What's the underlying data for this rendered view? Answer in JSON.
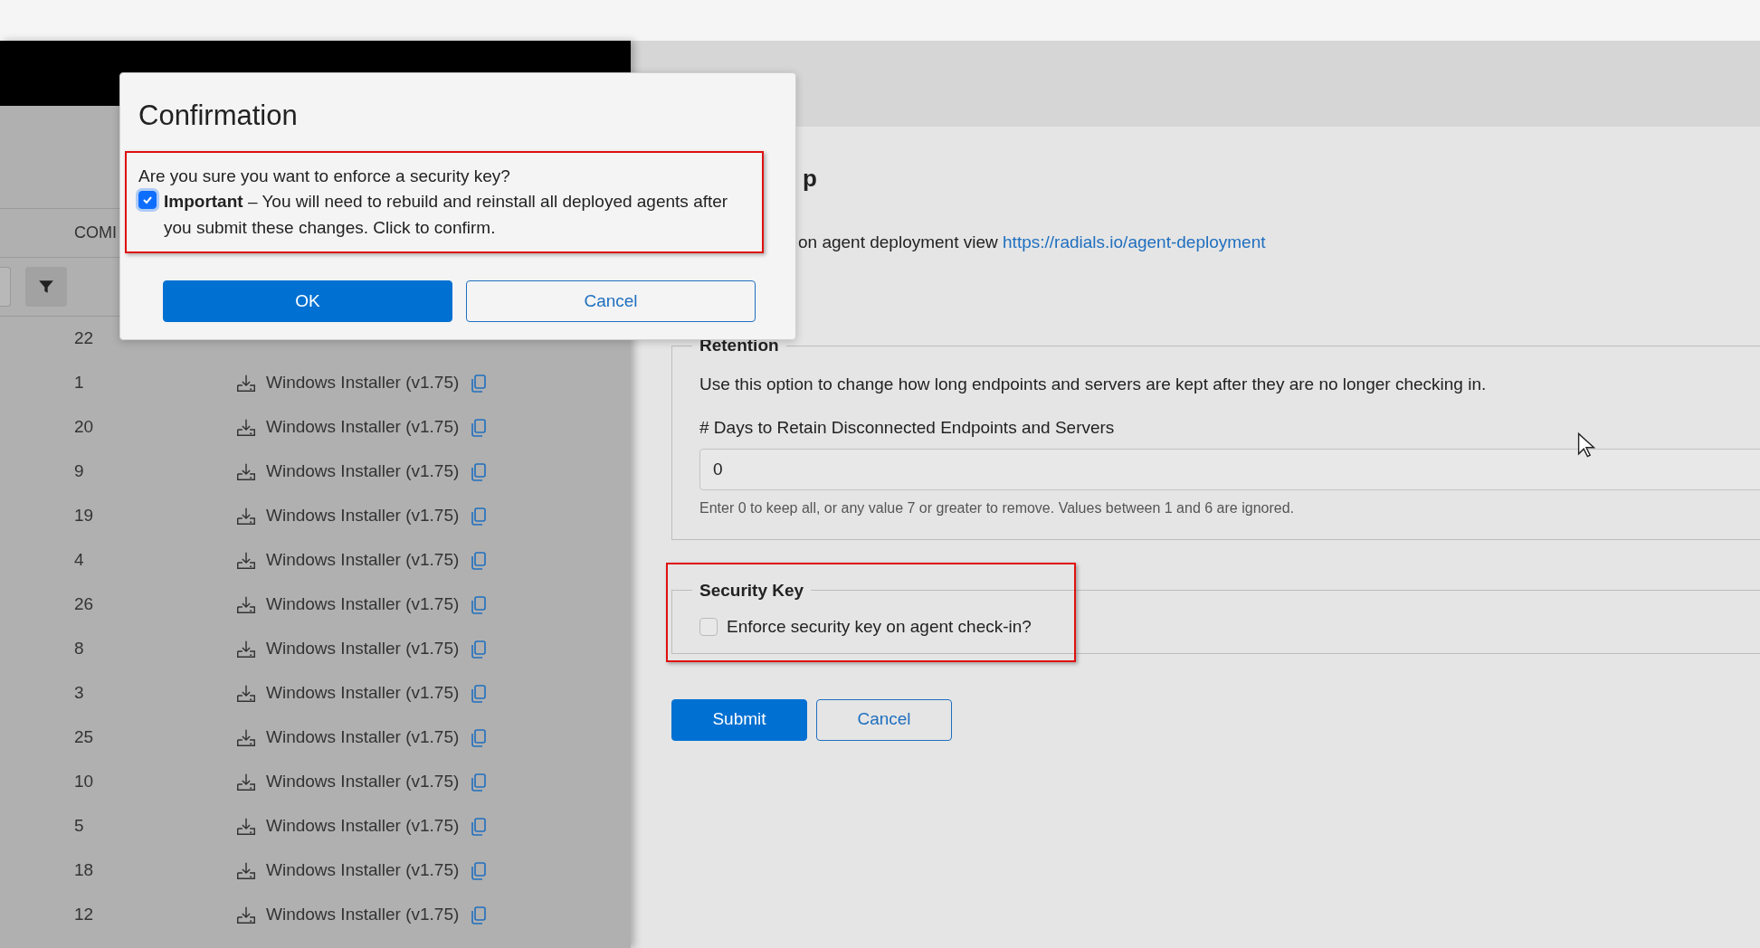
{
  "table": {
    "columns": [
      "COMI"
    ],
    "rows": [
      {
        "count": "22"
      },
      {
        "count": "1",
        "installer": "Windows Installer (v1.75)"
      },
      {
        "count": "20",
        "installer": "Windows Installer (v1.75)"
      },
      {
        "count": "9",
        "installer": "Windows Installer (v1.75)"
      },
      {
        "count": "19",
        "installer": "Windows Installer (v1.75)"
      },
      {
        "count": "4",
        "installer": "Windows Installer (v1.75)"
      },
      {
        "count": "26",
        "installer": "Windows Installer (v1.75)"
      },
      {
        "count": "8",
        "installer": "Windows Installer (v1.75)"
      },
      {
        "count": "3",
        "installer": "Windows Installer (v1.75)"
      },
      {
        "count": "25",
        "installer": "Windows Installer (v1.75)"
      },
      {
        "count": "10",
        "installer": "Windows Installer (v1.75)"
      },
      {
        "count": "5",
        "installer": "Windows Installer (v1.75)"
      },
      {
        "count": "18",
        "installer": "Windows Installer (v1.75)"
      },
      {
        "count": "12",
        "installer": "Windows Installer (v1.75)"
      }
    ]
  },
  "settings": {
    "heading": "p",
    "deployment_note": {
      "text": "on agent deployment view",
      "link": "https://radials.io/agent-deployment"
    },
    "retention": {
      "legend": "Retention",
      "description": "Use this option to change how long endpoints and servers are kept after they are no longer checking in.",
      "field_label": "# Days to Retain Disconnected Endpoints and Servers",
      "value": "0",
      "help": "Enter 0 to keep all, or any value 7 or greater to remove. Values between 1 and 6 are ignored."
    },
    "security_key": {
      "legend": "Security Key",
      "checkbox": {
        "label": "Enforce security key on agent check-in?",
        "checked": false
      }
    },
    "buttons": [
      {
        "label": "Submit",
        "kind": "primary"
      },
      {
        "label": "Cancel",
        "kind": "secondary"
      }
    ]
  },
  "dialog": {
    "title": "Confirmation",
    "question": "Are you sure you want to enforce a security key?",
    "checkbox": {
      "checked": true,
      "text": "**Important** – You will need to rebuild and reinstall all deployed agents after you submit these changes. Click to confirm."
    },
    "buttons": [
      {
        "label": "OK",
        "kind": "primary"
      },
      {
        "label": "Cancel",
        "kind": "secondary"
      }
    ]
  }
}
